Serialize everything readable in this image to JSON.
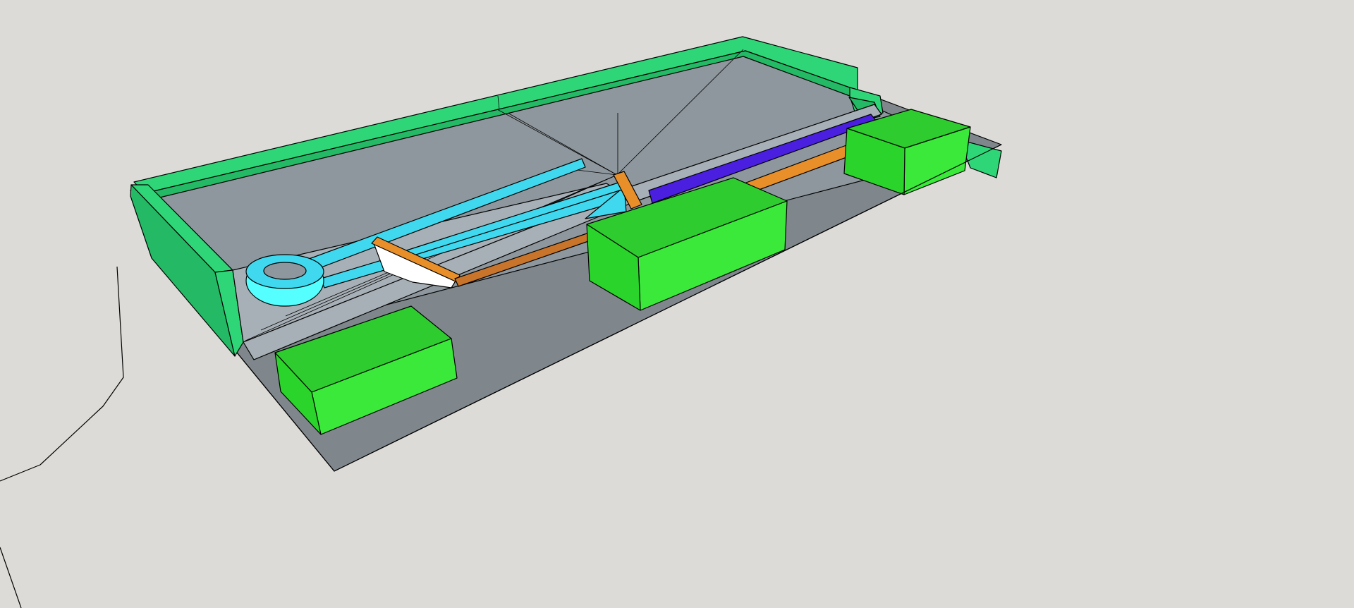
{
  "app": {
    "viewport_label": "",
    "background_color": "#dcdbd7"
  },
  "model": {
    "colors": {
      "platform_top": "#8e979d",
      "platform_shadow": "#7f878c",
      "platform_light": "#a7b0b6",
      "wall_green": "#2fd677",
      "wall_green_dark": "#24b964",
      "box_green_top": "#2ecc2e",
      "box_green_side": "#3ae93a",
      "box_green_front": "#2ad42a",
      "cyan": "#3fd8ee",
      "cyan_ring": "#55ffff",
      "orange": "#e88f2a",
      "orange_dark": "#c8742a",
      "blue_violet": "#4a1fe0",
      "white": "#ffffff",
      "edge": "#000000"
    }
  }
}
